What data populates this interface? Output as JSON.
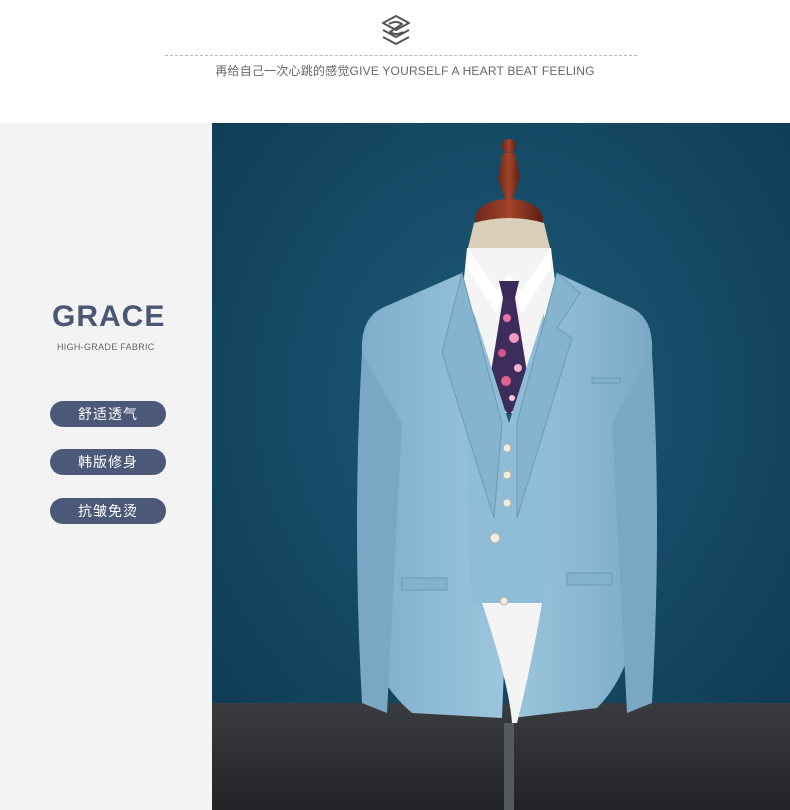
{
  "header": {
    "logo_icon": "stacked-layers-logo",
    "tagline": "再给自己一次心跳的感觉GIVE YOURSELF A HEART BEAT FEELING"
  },
  "panel": {
    "title": "GRACE",
    "subtitle": "HIGH-GRADE FABRIC",
    "features": [
      "舒适透气",
      "韩版修身",
      "抗皱免烫"
    ]
  },
  "photo": {
    "subject": "light-blue-three-piece-suit-on-mannequin"
  },
  "colors": {
    "accent": "#4b5877",
    "panel_bg": "#f3f3f3",
    "photo_bg": "#144a66",
    "suit": "#8db9d4"
  }
}
